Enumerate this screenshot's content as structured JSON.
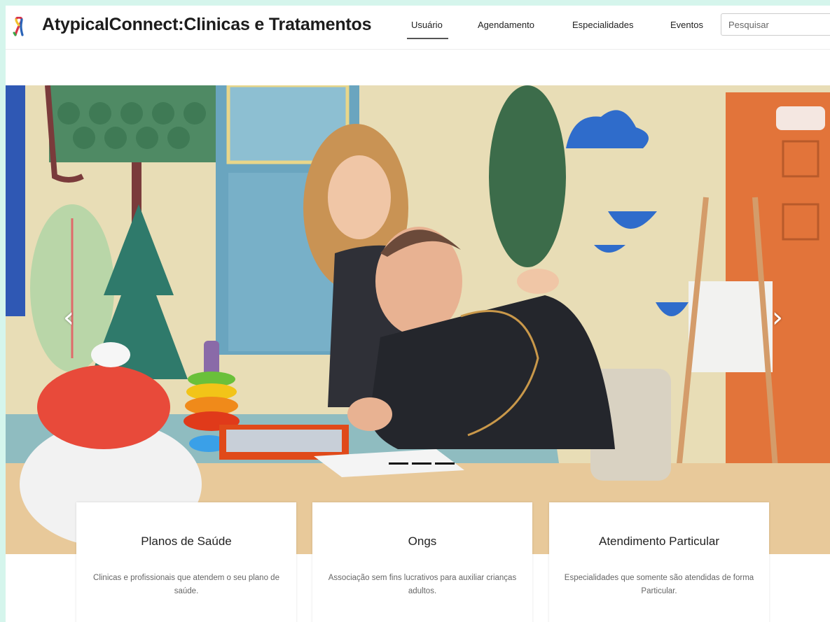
{
  "header": {
    "brand": "AtypicalConnect:Clinicas e Tratamentos",
    "logo_icon": "awareness-ribbon-icon",
    "nav": [
      {
        "label": "Usuário",
        "active": true
      },
      {
        "label": "Agendamento",
        "active": false
      },
      {
        "label": "Especialidades",
        "active": false
      },
      {
        "label": "Eventos",
        "active": false
      }
    ],
    "search": {
      "placeholder": "Pesquisar",
      "value": ""
    }
  },
  "carousel": {
    "prev_label": "‹",
    "next_label": "›",
    "slide_count": 3,
    "active_slide": 1
  },
  "cards": [
    {
      "title": "Planos de Saúde",
      "text": "Clinicas e profissionais que atendem o seu plano de saúde."
    },
    {
      "title": "Ongs",
      "text": "Associação sem fins lucrativos para auxiliar crianças adultos."
    },
    {
      "title": "Atendimento Particular",
      "text": "Especialidades que somente são atendidas de forma Particular."
    }
  ],
  "colors": {
    "page_background": "#d5f5ec",
    "active_underline": "#555555"
  }
}
